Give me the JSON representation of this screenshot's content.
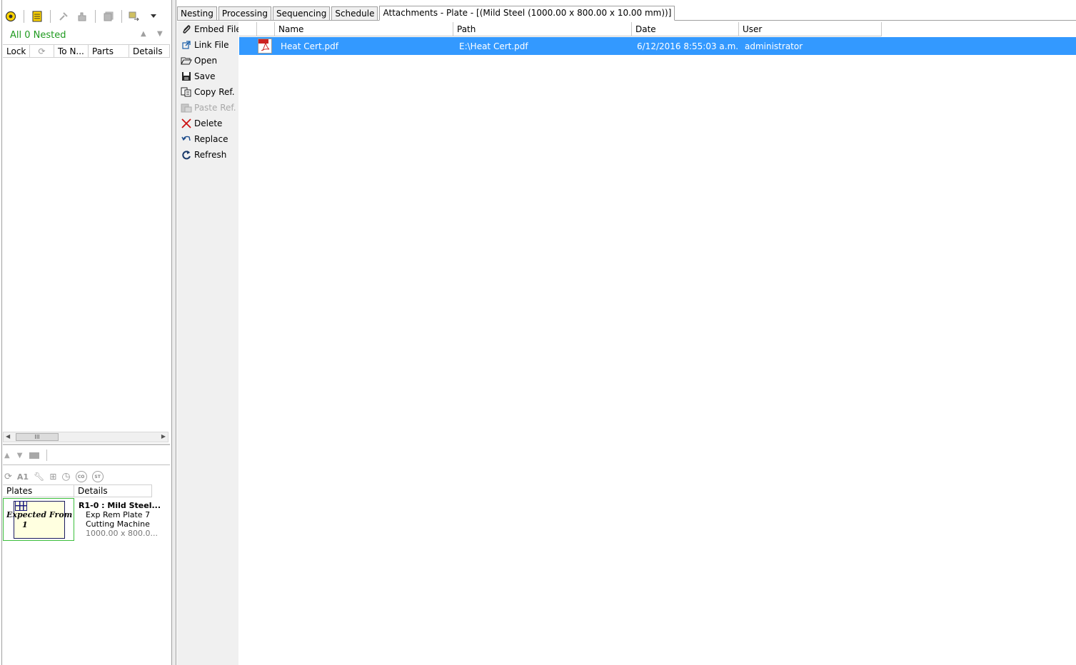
{
  "left_panel": {
    "nested_label": "All 0 Nested",
    "grid_columns": [
      "Lock",
      "",
      "To N...",
      "Parts",
      "Details"
    ],
    "scroll_thumb": "III",
    "plates_columns": [
      "Plates",
      "Details"
    ],
    "plate": {
      "thumb_line1": "Expected From",
      "thumb_line2": "1",
      "title": "R1-0 : Mild Steel...",
      "line1": "Exp Rem Plate 7",
      "line2": "Cutting Machine",
      "line3": "1000.00 x 800.0..."
    },
    "icon_row_labels": [
      "A1",
      "CO",
      "ST"
    ]
  },
  "tabs": [
    {
      "label": "Nesting"
    },
    {
      "label": "Processing"
    },
    {
      "label": "Sequencing"
    },
    {
      "label": "Schedule"
    },
    {
      "label": "Attachments - Plate - [(Mild Steel (1000.00 x 800.00 x 10.00 mm))]"
    }
  ],
  "sidebar": {
    "items": [
      {
        "label": "Embed File",
        "icon": "paperclip-icon"
      },
      {
        "label": "Link File",
        "icon": "link-icon"
      },
      {
        "label": "Open",
        "icon": "folder-open-icon"
      },
      {
        "label": "Save",
        "icon": "save-icon"
      },
      {
        "label": "Copy Ref.",
        "icon": "copy-icon"
      },
      {
        "label": "Paste Ref.",
        "icon": "paste-icon"
      },
      {
        "label": "Delete",
        "icon": "delete-icon"
      },
      {
        "label": "Replace",
        "icon": "replace-icon"
      },
      {
        "label": "Refresh",
        "icon": "refresh-icon"
      }
    ]
  },
  "attachments": {
    "columns": [
      "",
      "Name",
      "Path",
      "Date",
      "User"
    ],
    "rows": [
      {
        "name": "Heat Cert.pdf",
        "path": "E:\\Heat Cert.pdf",
        "date": "6/12/2016 8:55:03 a.m.",
        "user": "administrator"
      }
    ]
  },
  "colors": {
    "selection": "#3399ff",
    "nested_green": "#1f9a1f",
    "plate_border": "#3cbf3c",
    "delete_red": "#cc1111"
  }
}
